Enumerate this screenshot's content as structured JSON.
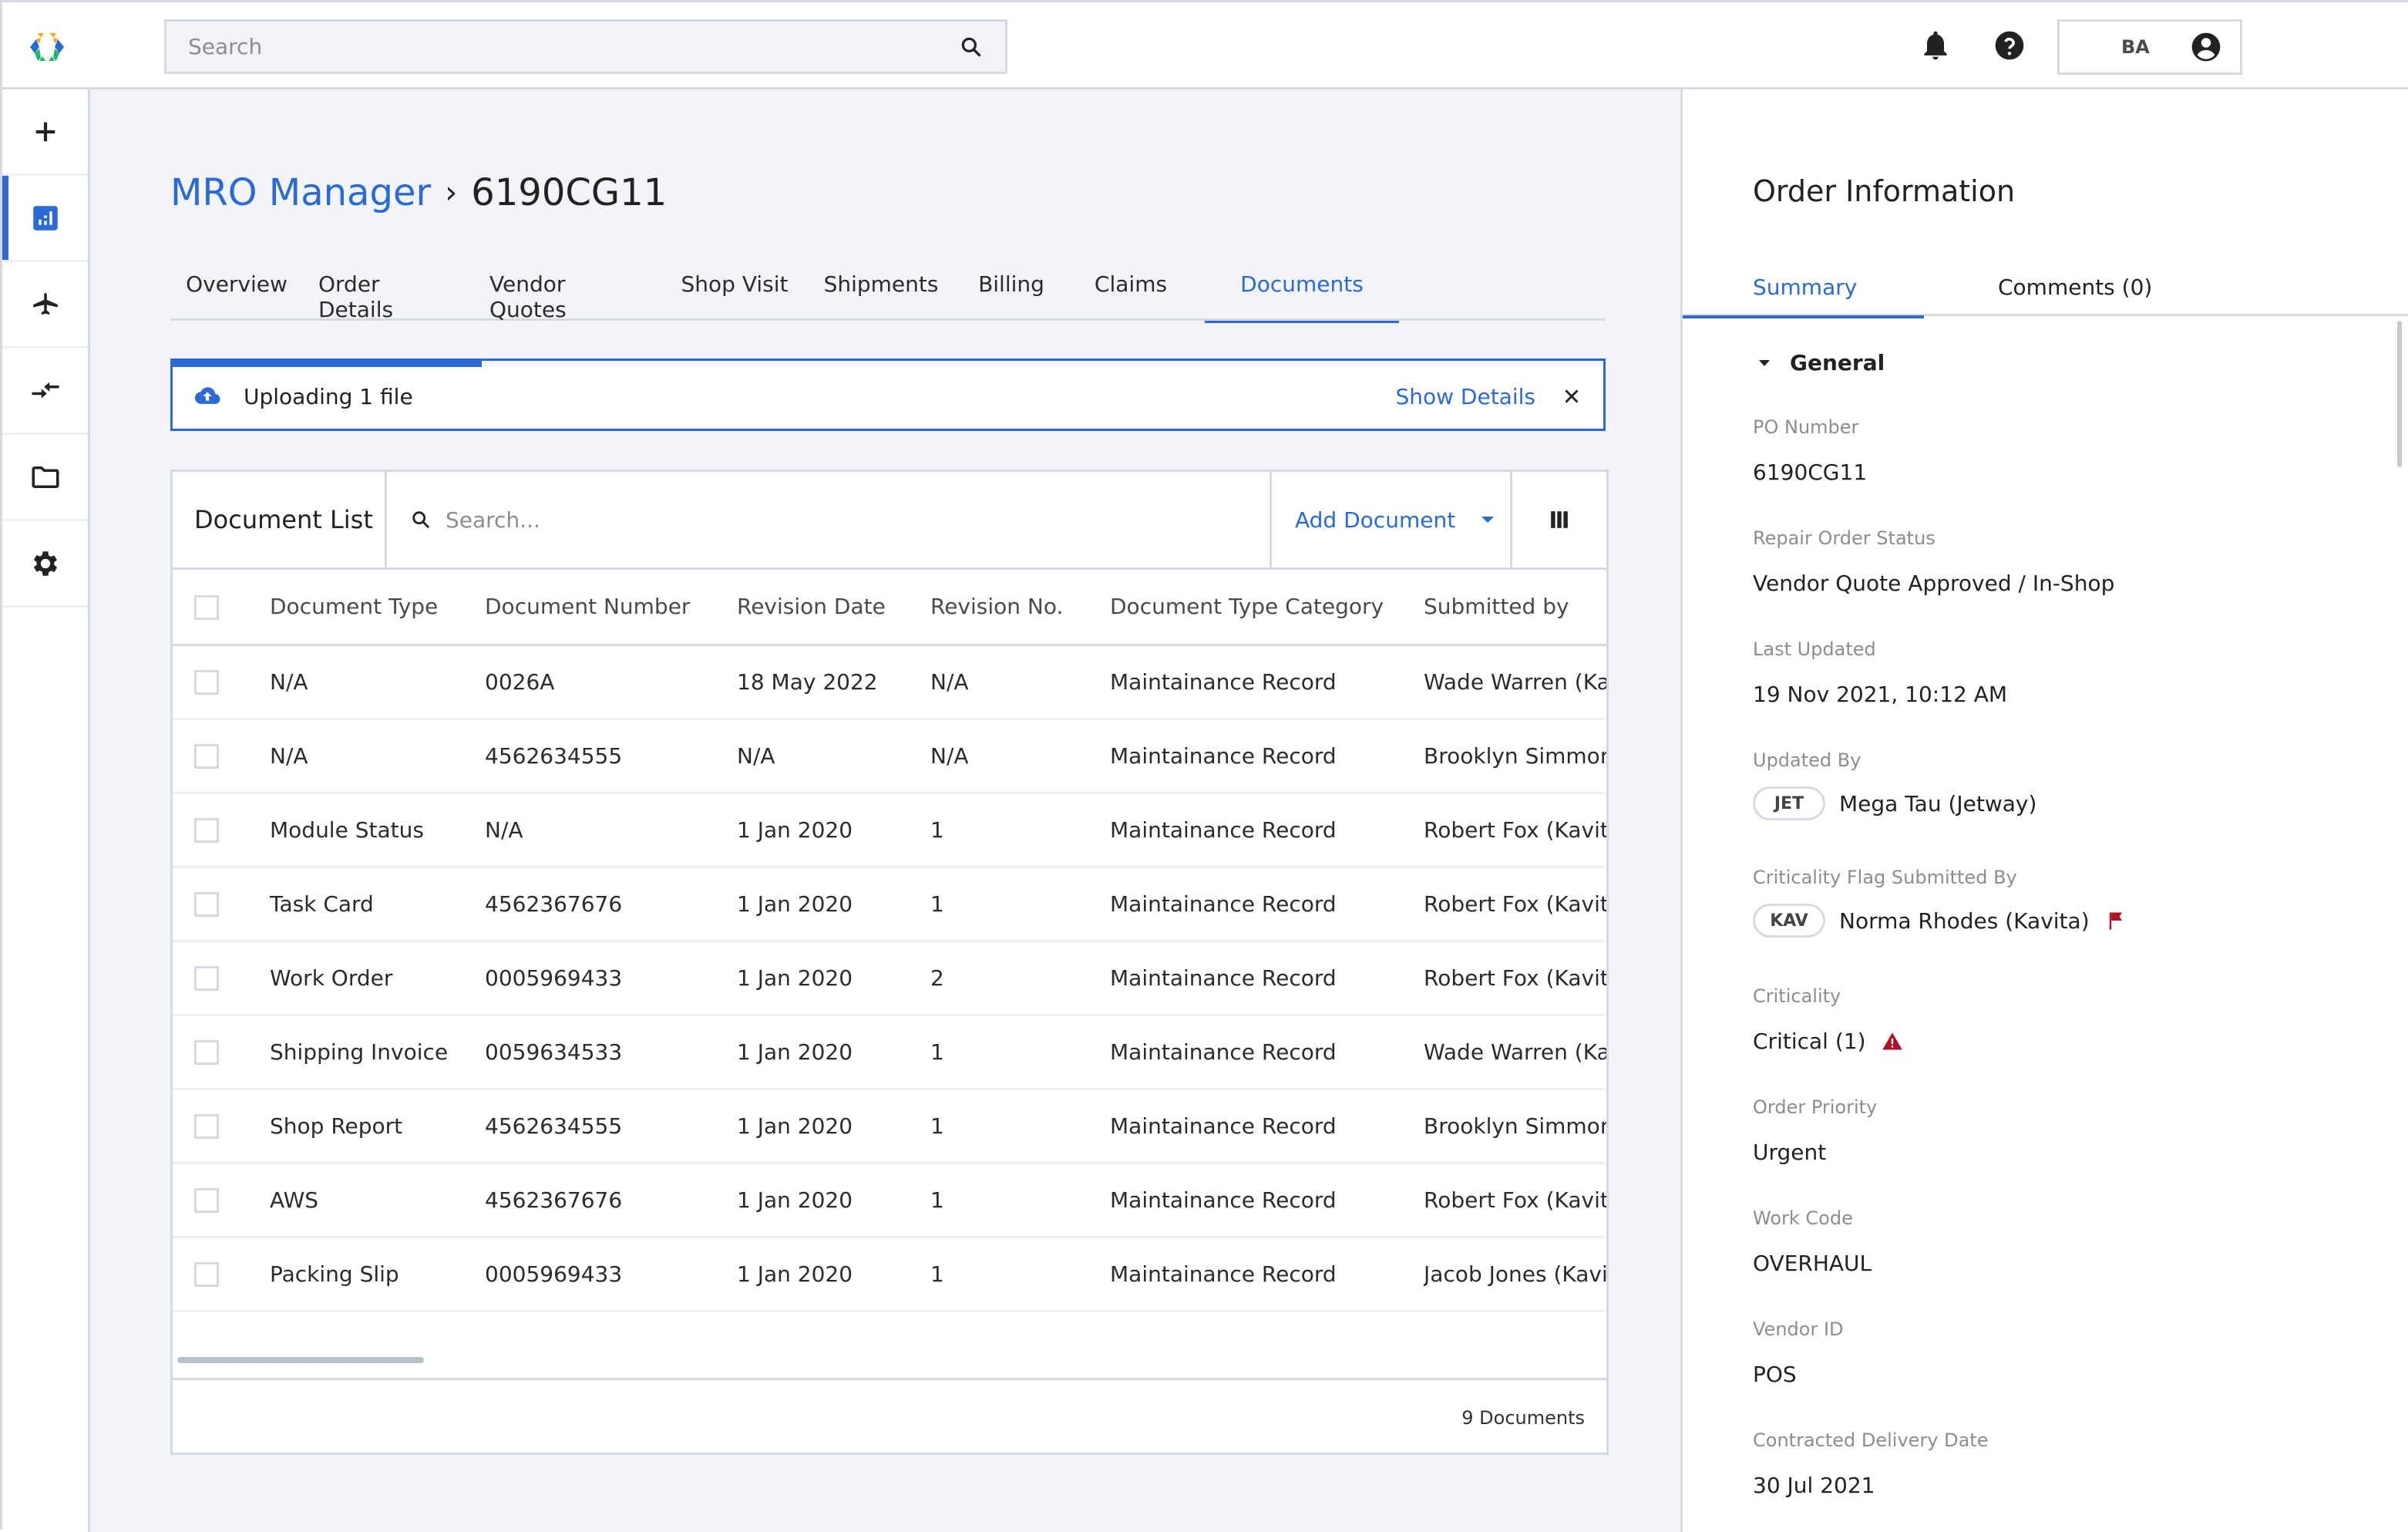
{
  "topbar": {
    "search_placeholder": "Search",
    "user_initials": "BA",
    "icons": [
      "logo-icon",
      "search-icon",
      "bell-icon",
      "help-icon",
      "account-circle-icon"
    ]
  },
  "sidebar": {
    "items": [
      {
        "name": "add",
        "icon": "plus-icon",
        "active": false
      },
      {
        "name": "dashboard",
        "icon": "bar-chart-icon",
        "active": true
      },
      {
        "name": "aircraft",
        "icon": "airplane-icon",
        "active": false
      },
      {
        "name": "transfers",
        "icon": "swap-arrows-icon",
        "active": false
      },
      {
        "name": "folder",
        "icon": "folder-icon",
        "active": false
      },
      {
        "name": "settings",
        "icon": "gear-icon",
        "active": false
      }
    ]
  },
  "colors": {
    "accent": "#2a6ad6",
    "critical": "#b0102a",
    "border": "#d5dae0",
    "main_bg": "#f2f4f7"
  },
  "breadcrumb": {
    "parent": "MRO Manager",
    "separator": "›",
    "current": "6190CG11"
  },
  "tabs": [
    {
      "label": "Overview",
      "active": false
    },
    {
      "label": "Order Details",
      "active": false
    },
    {
      "label": "Vendor Quotes",
      "active": false
    },
    {
      "label": "Shop Visit",
      "active": false
    },
    {
      "label": "Shipments",
      "active": false
    },
    {
      "label": "Billing",
      "active": false
    },
    {
      "label": "Claims",
      "active": false
    },
    {
      "label": "Documents",
      "active": true
    }
  ],
  "upload": {
    "text": "Uploading 1 file",
    "progress_percent": 21.6,
    "show_details_label": "Show Details"
  },
  "document_list": {
    "title": "Document List",
    "search_placeholder": "Search...",
    "add_document_label": "Add Document",
    "columns": [
      "Document Type",
      "Document Number",
      "Revision Date",
      "Revision No.",
      "Document Type Category",
      "Submitted by"
    ],
    "rows": [
      [
        "N/A",
        "0026A",
        "18 May 2022",
        "N/A",
        "Maintainance Record",
        "Wade Warren (Kavita)"
      ],
      [
        "N/A",
        "4562634555",
        "N/A",
        "N/A",
        "Maintainance Record",
        "Brooklyn Simmons (Kavita)"
      ],
      [
        "Module Status",
        "N/A",
        "1 Jan 2020",
        "1",
        "Maintainance Record",
        "Robert Fox (Kavita)"
      ],
      [
        "Task Card",
        "4562367676",
        "1 Jan 2020",
        "1",
        "Maintainance Record",
        "Robert Fox (Kavita)"
      ],
      [
        "Work Order",
        "0005969433",
        "1 Jan 2020",
        "2",
        "Maintainance Record",
        "Robert Fox (Kavita)"
      ],
      [
        "Shipping Invoice",
        "0059634533",
        "1 Jan 2020",
        "1",
        "Maintainance Record",
        "Wade Warren (Kavita)"
      ],
      [
        "Shop Report",
        "4562634555",
        "1 Jan 2020",
        "1",
        "Maintainance Record",
        "Brooklyn Simmons (Kavita)"
      ],
      [
        "AWS",
        "4562367676",
        "1 Jan 2020",
        "1",
        "Maintainance Record",
        "Robert Fox (Kavita)"
      ],
      [
        "Packing Slip",
        "0005969433",
        "1 Jan 2020",
        "1",
        "Maintainance Record",
        "Jacob Jones (Kavita)"
      ]
    ],
    "footer_count": "9 Documents"
  },
  "order_info": {
    "title": "Order Information",
    "tabs": [
      {
        "label": "Summary",
        "active": true
      },
      {
        "label": "Comments (0)",
        "active": false
      }
    ],
    "section": "General",
    "fields": [
      {
        "label": "PO Number",
        "value": "6190CG11"
      },
      {
        "label": "Repair Order Status",
        "value": "Vendor Quote Approved / In-Shop"
      },
      {
        "label": "Last Updated",
        "value": "19 Nov 2021, 10:12 AM"
      },
      {
        "label": "Updated By",
        "chip": "JET",
        "value": "Mega Tau (Jetway)"
      },
      {
        "label": "Criticality Flag Submitted By",
        "chip": "KAV",
        "value": "Norma Rhodes (Kavita)",
        "icon": "flag-icon"
      },
      {
        "label": "Criticality",
        "value": "Critical (1)",
        "icon": "warning-icon"
      },
      {
        "label": "Order Priority",
        "value": "Urgent"
      },
      {
        "label": "Work Code",
        "value": "OVERHAUL"
      },
      {
        "label": "Vendor ID",
        "value": "POS"
      },
      {
        "label": "Contracted Delivery Date",
        "value": "30 Jul 2021"
      }
    ]
  }
}
